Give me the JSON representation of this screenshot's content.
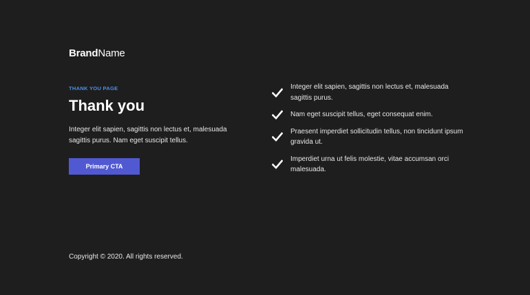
{
  "brand": {
    "bold": "Brand",
    "light": "Name"
  },
  "hero": {
    "eyebrow": "THANK YOU PAGE",
    "title": "Thank you",
    "body": "Integer elit sapien, sagittis non lectus et, malesuada sagittis purus. Nam eget suscipit tellus.",
    "cta_label": "Primary CTA"
  },
  "features": {
    "icon": "check-icon",
    "items": [
      {
        "text": "Integer elit sapien, sagittis non lectus et, malesuada sagittis purus."
      },
      {
        "text": "Nam eget suscipit tellus, eget consequat enim."
      },
      {
        "text": "Praesent imperdiet sollicitudin tellus, non tincidunt ipsum gravida ut."
      },
      {
        "text": "Imperdiet urna ut felis molestie, vitae accumsan orci malesuada."
      }
    ]
  },
  "footer": {
    "copyright": "Copyright © 2020. All rights reserved."
  },
  "colors": {
    "background": "#1e1e1f",
    "accent": "#5159d2",
    "eyebrow": "#4d8fe4",
    "text": "#ffffff"
  }
}
